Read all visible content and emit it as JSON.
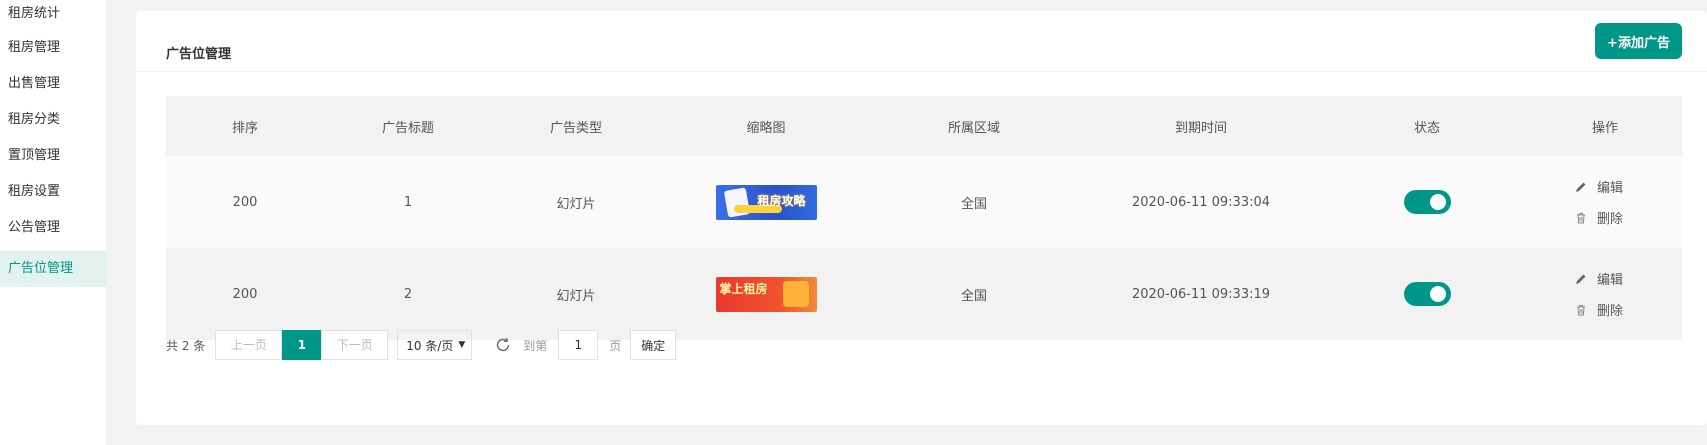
{
  "sidebar": {
    "items": [
      {
        "label": "租房统计"
      },
      {
        "label": "租房管理"
      },
      {
        "label": "出售管理"
      },
      {
        "label": "租房分类"
      },
      {
        "label": "置顶管理"
      },
      {
        "label": "租房设置"
      },
      {
        "label": "公告管理"
      },
      {
        "label": "广告位管理",
        "active": true
      }
    ]
  },
  "card": {
    "title": "广告位管理",
    "add_button": "+添加广告"
  },
  "table": {
    "headers": [
      "排序",
      "广告标题",
      "广告类型",
      "缩略图",
      "所属区域",
      "到期时间",
      "状态",
      "操作"
    ],
    "rows": [
      {
        "sort": "200",
        "title": "1",
        "type": "幻灯片",
        "thumb_text": "租房攻略",
        "region": "全国",
        "expires": "2020-06-11 09:33:04",
        "status_on": true,
        "edit": "编辑",
        "delete": "删除"
      },
      {
        "sort": "200",
        "title": "2",
        "type": "幻灯片",
        "thumb_text": "掌上租房",
        "region": "全国",
        "expires": "2020-06-11 09:33:19",
        "status_on": true,
        "edit": "编辑",
        "delete": "删除"
      }
    ]
  },
  "pagination": {
    "total": "共 2 条",
    "prev": "上一页",
    "current": "1",
    "next": "下一页",
    "page_size": "10 条/页",
    "goto_label": "到第",
    "goto_value": "1",
    "page_unit": "页",
    "confirm": "确定"
  },
  "colors": {
    "accent": "#009688",
    "active_bg": "#e2f2ef"
  }
}
